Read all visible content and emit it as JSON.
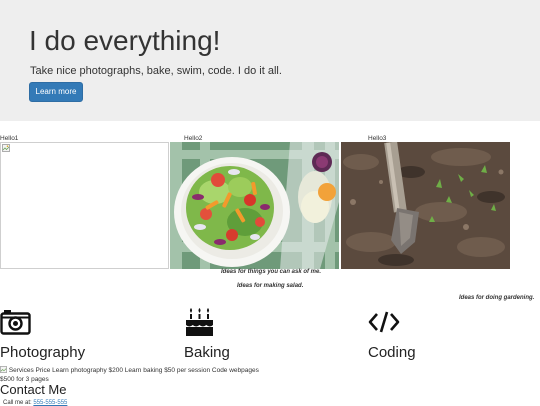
{
  "hero": {
    "title": "I do everything!",
    "subtitle": "Take nice photographs, bake, swim, code. I do it all.",
    "button_label": "Learn more"
  },
  "gallery": [
    {
      "label": "Hello1",
      "caption": "Ideas for things you can ask of me.",
      "image": "broken-image"
    },
    {
      "label": "Hello2",
      "caption": "Ideas for making salad.",
      "image": "salad-bowl-photo"
    },
    {
      "label": "Hello3",
      "caption": "Ideas for doing gardening.",
      "image": "garden-spade-soil-photo"
    }
  ],
  "services": [
    {
      "label": "Photography",
      "icon": "camera-icon"
    },
    {
      "label": "Baking",
      "icon": "birthday-cake-icon"
    },
    {
      "label": "Coding",
      "icon": "code-icon"
    }
  ],
  "pricing_text": "Services Price Learn photography $200 Learn baking $50 per session Code webpages $500 for 3 pages",
  "contact": {
    "title": "Contact Me",
    "call_label": "Call me at:",
    "phone": "555-555-555"
  },
  "colors": {
    "hero_bg": "#eeeeee",
    "button_bg": "#337ab7",
    "text": "#333333"
  }
}
